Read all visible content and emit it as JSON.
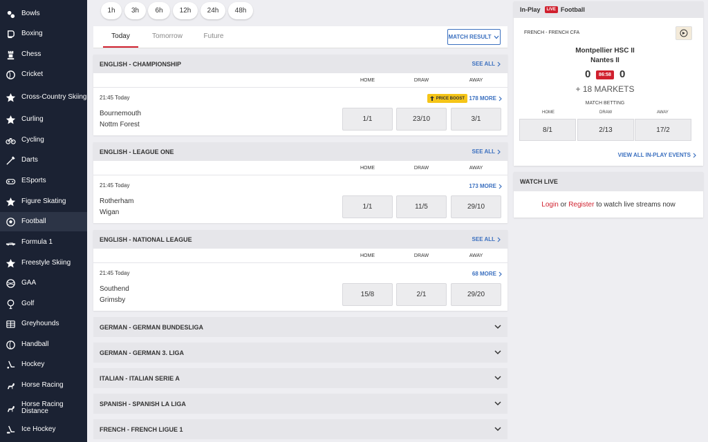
{
  "sidebar": {
    "items": [
      {
        "label": "Bowls",
        "icon": "bowls-icon"
      },
      {
        "label": "Boxing",
        "icon": "boxing-glove-icon"
      },
      {
        "label": "Chess",
        "icon": "chess-rook-icon"
      },
      {
        "label": "Cricket",
        "icon": "cricket-ball-icon"
      },
      {
        "label": "Cross-Country Skiing",
        "icon": "star-icon"
      },
      {
        "label": "Curling",
        "icon": "star-icon"
      },
      {
        "label": "Cycling",
        "icon": "bicycle-icon"
      },
      {
        "label": "Darts",
        "icon": "dart-icon"
      },
      {
        "label": "ESports",
        "icon": "gamepad-icon"
      },
      {
        "label": "Figure Skating",
        "icon": "star-icon"
      },
      {
        "label": "Football",
        "icon": "football-icon",
        "active": true
      },
      {
        "label": "Formula 1",
        "icon": "race-car-icon"
      },
      {
        "label": "Freestyle Skiing",
        "icon": "star-icon"
      },
      {
        "label": "GAA",
        "icon": "gaa-ball-icon"
      },
      {
        "label": "Golf",
        "icon": "golf-ball-icon"
      },
      {
        "label": "Greyhounds",
        "icon": "greyhound-icon"
      },
      {
        "label": "Handball",
        "icon": "handball-icon"
      },
      {
        "label": "Hockey",
        "icon": "hockey-stick-icon"
      },
      {
        "label": "Horse Racing",
        "icon": "horse-icon"
      },
      {
        "label": "Horse Racing Distance",
        "icon": "horse-icon"
      },
      {
        "label": "Ice Hockey",
        "icon": "ice-hockey-icon"
      }
    ]
  },
  "time_filters": [
    "1h",
    "3h",
    "6h",
    "12h",
    "24h",
    "48h"
  ],
  "tabs": [
    "Today",
    "Tomorrow",
    "Future"
  ],
  "match_result_label": "MATCH RESULT",
  "columns": {
    "home": "HOME",
    "draw": "DRAW",
    "away": "AWAY"
  },
  "see_all": "SEE ALL",
  "leagues": [
    {
      "title": "ENGLISH - CHAMPIONSHIP",
      "time": "21:45 Today",
      "home": "Bournemouth",
      "away": "Nottm Forest",
      "more": "178 MORE",
      "boost": "PRICE BOOST",
      "odds": [
        "1/1",
        "23/10",
        "3/1"
      ]
    },
    {
      "title": "ENGLISH - LEAGUE ONE",
      "time": "21:45 Today",
      "home": "Rotherham",
      "away": "Wigan",
      "more": "173 MORE",
      "odds": [
        "1/1",
        "11/5",
        "29/10"
      ]
    },
    {
      "title": "ENGLISH - NATIONAL LEAGUE",
      "time": "21:45 Today",
      "home": "Southend",
      "away": "Grimsby",
      "more": "68 MORE",
      "odds": [
        "15/8",
        "2/1",
        "29/20"
      ]
    }
  ],
  "collapsed_leagues": [
    "GERMAN - GERMAN BUNDESLIGA",
    "GERMAN - GERMAN 3. LIGA",
    "ITALIAN - ITALIAN SERIE A",
    "SPANISH - SPANISH LA LIGA",
    "FRENCH - FRENCH LIGUE 1"
  ],
  "inplay": {
    "title": "In-Play",
    "live": "LIVE",
    "sport": "Football",
    "league": "FRENCH - FRENCH CFA",
    "home_team": "Montpellier HSC II",
    "away_team": "Nantes II",
    "home_score": "0",
    "away_score": "0",
    "clock": "86:58",
    "markets": "+ 18 MARKETS",
    "betting_title": "MATCH BETTING",
    "odds": [
      "8/1",
      "2/13",
      "17/2"
    ],
    "view_all": "VIEW ALL IN-PLAY EVENTS"
  },
  "watch_live": {
    "title": "WATCH LIVE",
    "login": "Login",
    "or": " or ",
    "register": "Register",
    "suffix": " to watch live streams now"
  },
  "colors": {
    "sidebar": "#1b2233",
    "accent_red": "#d0202e",
    "link_blue": "#3a6fbf",
    "boost_yellow": "#f5c518"
  }
}
